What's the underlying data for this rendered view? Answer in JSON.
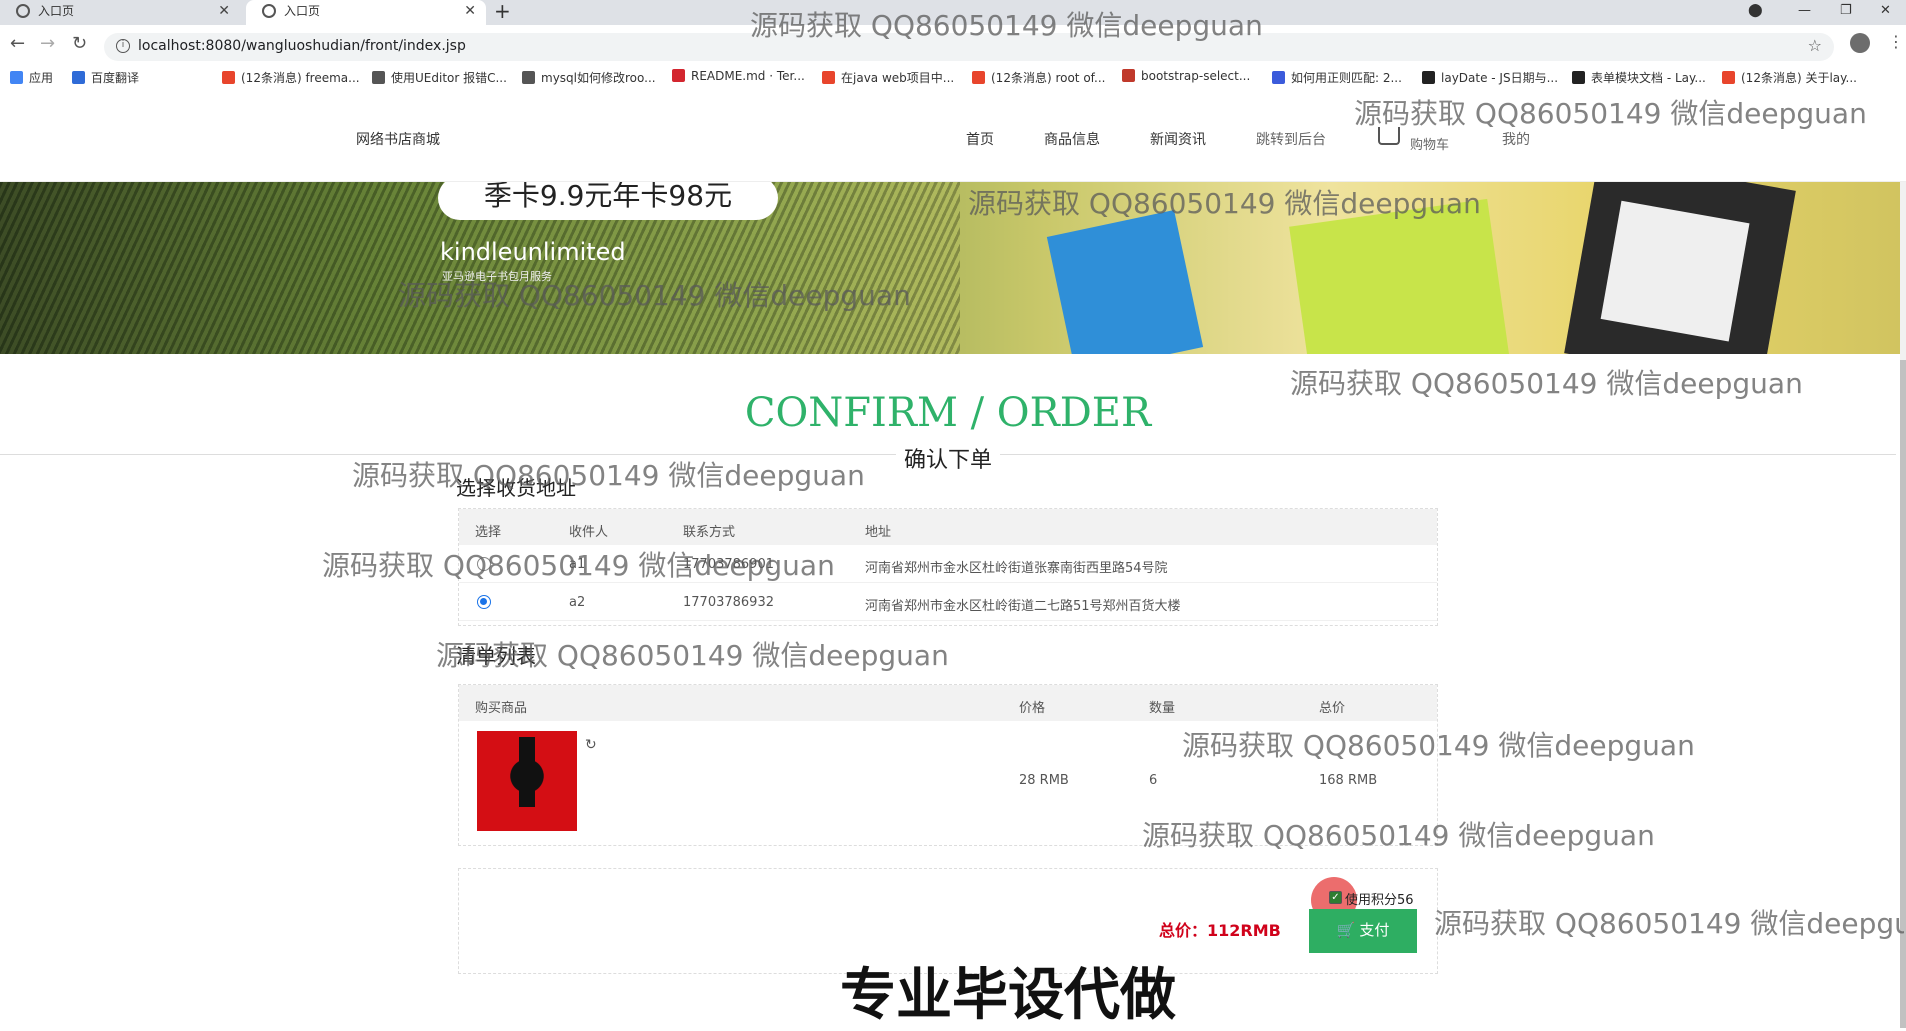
{
  "browser": {
    "tabs": [
      {
        "title": "入口页",
        "active": false
      },
      {
        "title": "入口页",
        "active": true
      }
    ],
    "new_tab": "+",
    "url": "localhost:8080/wangluoshudian/front/index.jsp",
    "bookmarks": [
      {
        "label": "应用",
        "color": "#4285f4"
      },
      {
        "label": "百度翻译",
        "color": "#2f6bd7"
      },
      {
        "label": "(12条消息) freema...",
        "color": "#e8452c"
      },
      {
        "label": "使用UEditor 报错C...",
        "color": "#555555"
      },
      {
        "label": "mysql如何修改roo...",
        "color": "#555555"
      },
      {
        "label": "README.md · Ter...",
        "color": "#d3262f"
      },
      {
        "label": "在java web项目中...",
        "color": "#e8452c"
      },
      {
        "label": "(12条消息) root of...",
        "color": "#e8452c"
      },
      {
        "label": "bootstrap-select...",
        "color": "#c0392b"
      },
      {
        "label": "如何用正则匹配: 2...",
        "color": "#3b5bdb"
      },
      {
        "label": "layDate - JS日期与...",
        "color": "#222222"
      },
      {
        "label": "表单模块文档 - Lay...",
        "color": "#222222"
      },
      {
        "label": "(12条消息) 关于lay...",
        "color": "#e8452c"
      }
    ]
  },
  "site": {
    "logo": "网络书店商城",
    "nav": [
      "首页",
      "商品信息",
      "新闻资讯",
      "跳转到后台",
      "购物车",
      "我的"
    ]
  },
  "banner": {
    "promo": "季卡9.9元年卡98元",
    "brand": "kindleunlimited",
    "brand_sub": "亚马逊电子书包月服务"
  },
  "page": {
    "title": "CONFIRM / ORDER",
    "subtitle": "确认下单"
  },
  "address": {
    "section_title": "选择收货地址",
    "headers": [
      "选择",
      "收件人",
      "联系方式",
      "地址"
    ],
    "rows": [
      {
        "selected": false,
        "name": "a1",
        "phone": "17703786901",
        "address": "河南省郑州市金水区杜岭街道张寨南街西里路54号院"
      },
      {
        "selected": true,
        "name": "a2",
        "phone": "17703786932",
        "address": "河南省郑州市金水区杜岭街道二七路51号郑州百货大楼"
      }
    ]
  },
  "items": {
    "section_title": "清单列表",
    "headers": [
      "购买商品",
      "价格",
      "数量",
      "总价"
    ],
    "rows": [
      {
        "price": "28 RMB",
        "qty": "6",
        "total": "168 RMB"
      }
    ]
  },
  "payment": {
    "use_points": "使用积分56",
    "points_checked": true,
    "total": "总价：112RMB",
    "pay_label": "支付"
  },
  "watermark": {
    "text": "源码获取 QQ86050149 微信deepguan",
    "big": "专业毕设代做"
  },
  "colors": {
    "accent": "#2eae62",
    "title_green": "#2fb26a",
    "price_red": "#d0021b"
  }
}
